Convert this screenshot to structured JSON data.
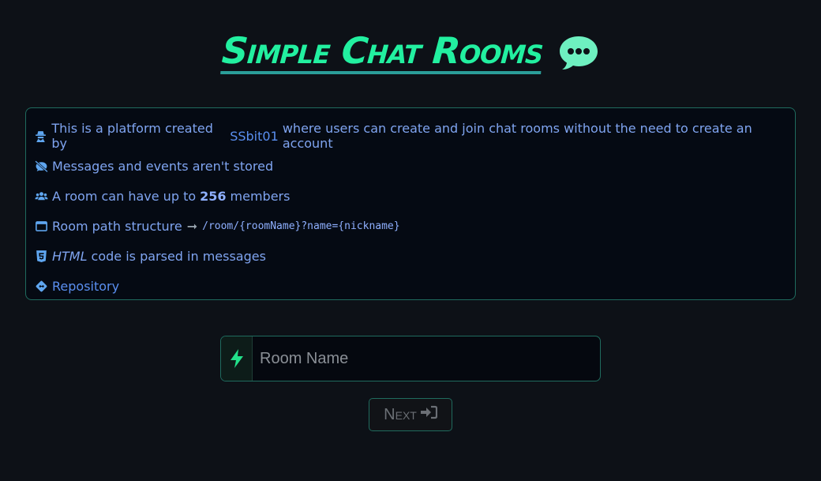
{
  "header": {
    "title": "Simple Chat Rooms",
    "title_icon": "speech-bubble-icon"
  },
  "info": {
    "platform_prefix": "This is a platform created by",
    "platform_author": "SSbit01",
    "platform_suffix": "where users can create and join chat rooms without the need to create an account",
    "storage_text": "Messages and events aren't stored",
    "members_prefix": "A room can have up to",
    "members_count": "256",
    "members_suffix": "members",
    "path_label": "Room path structure",
    "path_arrow": "➞",
    "path_value": "/room/{roomName}?name={nickname}",
    "html_word": "HTML",
    "html_suffix": "code is parsed in messages",
    "repo_label": "Repository"
  },
  "form": {
    "room_placeholder": "Room Name",
    "room_value": "",
    "next_label": "Next"
  },
  "colors": {
    "background": "#0d1117",
    "accent_green": "#22f0a0",
    "text_blue": "#7fa4f0",
    "border_teal": "#1f6b5e"
  }
}
